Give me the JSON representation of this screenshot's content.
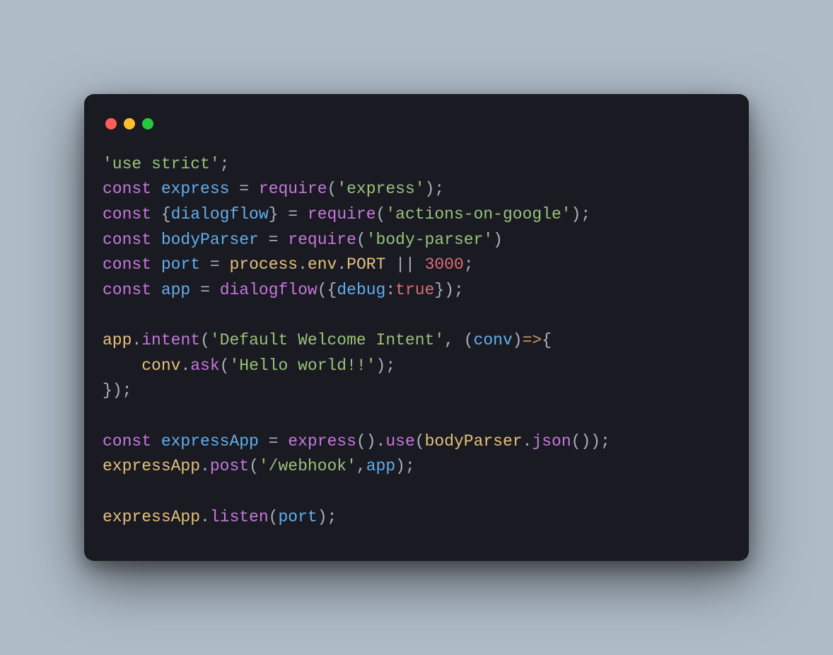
{
  "code": {
    "l1": {
      "s1": "'use strict'",
      "s2": ";"
    },
    "l2": {
      "kw": "const",
      "sp1": " ",
      "id": "express",
      "sp2": " ",
      "eq": "=",
      "sp3": " ",
      "fn": "require",
      "op": "(",
      "str": "'express'",
      "cp": ")",
      "semi": ";"
    },
    "l3": {
      "kw": "const",
      "sp1": " ",
      "ob": "{",
      "id": "dialogflow",
      "cb": "}",
      "sp2": " ",
      "eq": "=",
      "sp3": " ",
      "fn": "require",
      "op": "(",
      "str": "'actions-on-google'",
      "cp": ")",
      "semi": ";"
    },
    "l4": {
      "kw": "const",
      "sp1": " ",
      "id": "bodyParser",
      "sp2": " ",
      "eq": "=",
      "sp3": " ",
      "fn": "require",
      "op": "(",
      "str": "'body-parser'",
      "cp": ")"
    },
    "l5": {
      "kw": "const",
      "sp1": " ",
      "id": "port",
      "sp2": " ",
      "eq": "=",
      "sp3": " ",
      "obj": "process",
      "dot1": ".",
      "prop1": "env",
      "dot2": ".",
      "prop2": "PORT",
      "sp4": " ",
      "or": "||",
      "sp5": " ",
      "num": "3000",
      "semi": ";"
    },
    "l6": {
      "kw": "const",
      "sp1": " ",
      "id": "app",
      "sp2": " ",
      "eq": "=",
      "sp3": " ",
      "fn": "dialogflow",
      "op": "(",
      "ob": "{",
      "key": "debug",
      "colon": ":",
      "val": "true",
      "cb": "}",
      "cp": ")",
      "semi": ";"
    },
    "l8": {
      "obj": "app",
      "dot": ".",
      "fn": "intent",
      "op": "(",
      "str": "'Default Welcome Intent'",
      "comma": ",",
      "sp": " ",
      "op2": "(",
      "arg": "conv",
      "cp2": ")",
      "arrow": "=>",
      "ob": "{"
    },
    "l9": {
      "indent": "    ",
      "obj": "conv",
      "dot": ".",
      "fn": "ask",
      "op": "(",
      "str": "'Hello world!!'",
      "cp": ")",
      "semi": ";"
    },
    "l10": {
      "cb": "}",
      "cp": ")",
      "semi": ";"
    },
    "l12": {
      "kw": "const",
      "sp1": " ",
      "id": "expressApp",
      "sp2": " ",
      "eq": "=",
      "sp3": " ",
      "fn": "express",
      "op": "(",
      "cp": ")",
      "dot": ".",
      "fn2": "use",
      "op2": "(",
      "obj": "bodyParser",
      "dot2": ".",
      "fn3": "json",
      "op3": "(",
      "cp3": ")",
      "cp2": ")",
      "semi": ";"
    },
    "l13": {
      "obj": "expressApp",
      "dot": ".",
      "fn": "post",
      "op": "(",
      "str": "'/webhook'",
      "comma": ",",
      "arg": "app",
      "cp": ")",
      "semi": ";"
    },
    "l15": {
      "obj": "expressApp",
      "dot": ".",
      "fn": "listen",
      "op": "(",
      "arg": "port",
      "cp": ")",
      "semi": ";"
    }
  }
}
